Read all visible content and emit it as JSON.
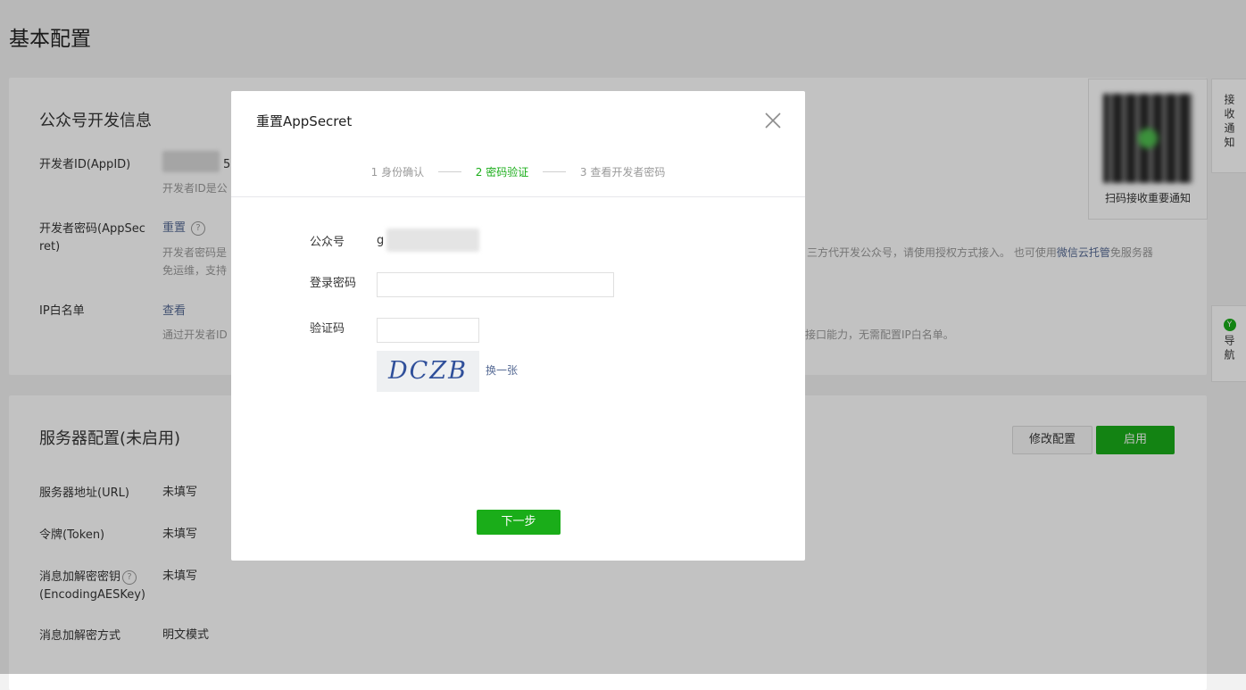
{
  "page": {
    "title": "基本配置"
  },
  "dev_info": {
    "title": "公众号开发信息",
    "appid_label": "开发者ID(AppID)",
    "appid_visible": "5",
    "appid_desc": "开发者ID是公",
    "secret_label_1": "开发者密码(AppSec",
    "secret_label_2": "ret)",
    "secret_action": "重置",
    "secret_desc_1a": "开发者密码是",
    "secret_desc_1b": "三方代开发公众号，请使用授权方式接入。 也可使用",
    "secret_desc_link": "微信云托管",
    "secret_desc_1c": "免服务器",
    "secret_desc_2": "免运维，支持",
    "ip_label": "IP白名单",
    "ip_action": "查看",
    "ip_desc_a": "通过开发者ID",
    "ip_desc_b": "众号接口能力，无需配置IP白名单。"
  },
  "server_config": {
    "title": "服务器配置(未启用)",
    "modify_button": "修改配置",
    "enable_button": "启用",
    "url_label": "服务器地址(URL)",
    "url_value": "未填写",
    "token_label": "令牌(Token)",
    "token_value": "未填写",
    "aes_label_1": "消息加解密密钥",
    "aes_label_2": "(EncodingAESKey)",
    "aes_value": "未填写",
    "mode_label": "消息加解密方式",
    "mode_value": "明文模式"
  },
  "qr": {
    "caption": "扫码接收重要通知"
  },
  "side": {
    "notify": "接收通知",
    "nav": "导航",
    "nav_badge": "Y"
  },
  "dialog": {
    "title": "重置AppSecret",
    "steps": [
      "1 身份确认",
      "2 密码验证",
      "3 查看开发者密码"
    ],
    "active_step": 2,
    "account_label": "公众号",
    "account_prefix": "g",
    "password_label": "登录密码",
    "password_value": "",
    "captcha_label": "验证码",
    "captcha_value": "",
    "captcha_text": "DCZB",
    "captcha_refresh": "换一张",
    "next_button": "下一步"
  },
  "colors": {
    "accent": "#1aad19",
    "link": "#576b95"
  }
}
